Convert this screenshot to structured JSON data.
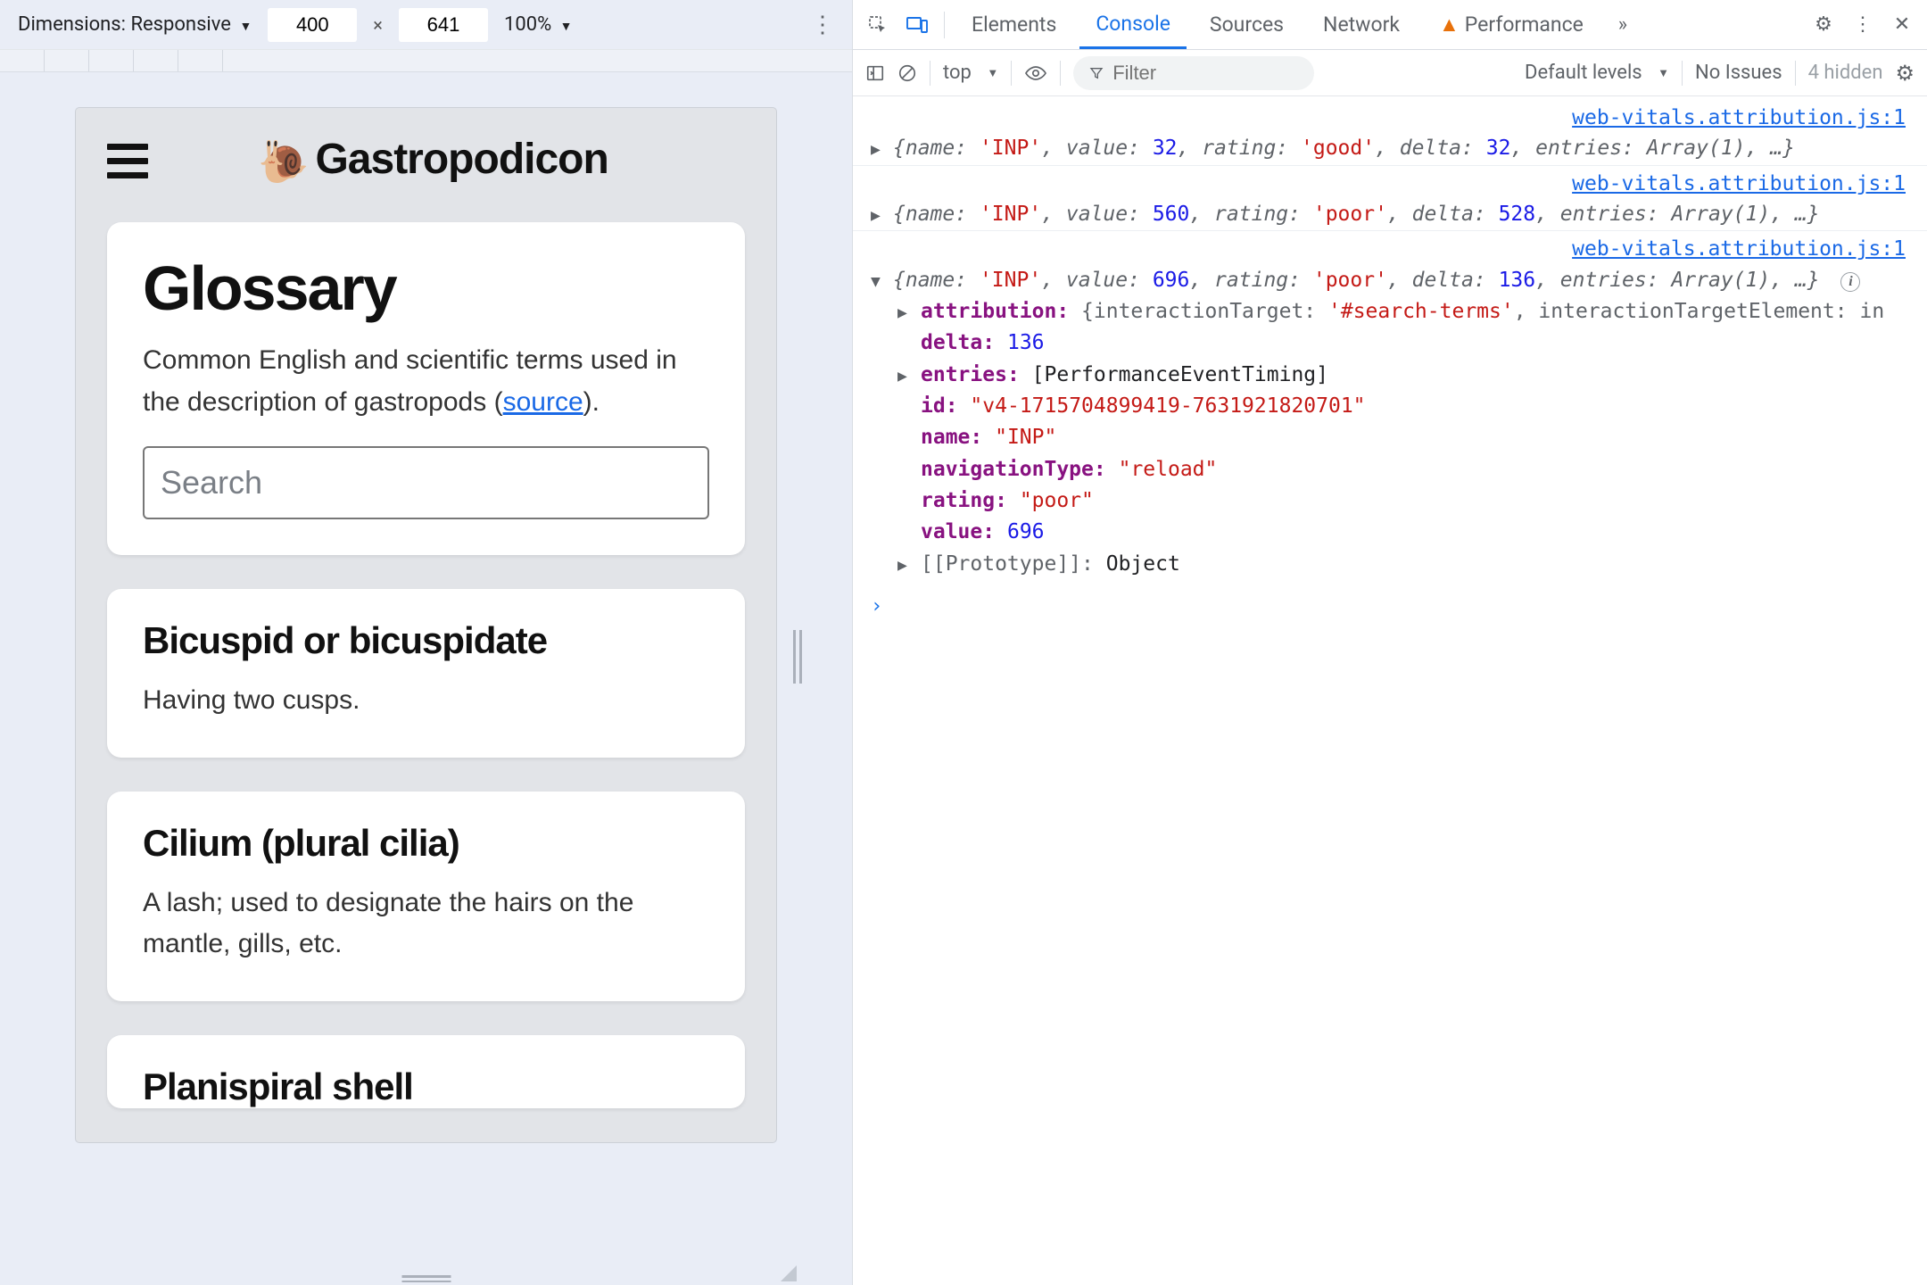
{
  "device_toolbar": {
    "dimensions_label": "Dimensions:",
    "device_name": "Responsive",
    "width": "400",
    "height": "641",
    "zoom": "100%"
  },
  "app": {
    "title": "Gastropodicon",
    "snail": "🐌",
    "glossary_heading": "Glossary",
    "glossary_desc_prefix": "Common English and scientific terms used in the description of gastropods (",
    "glossary_source": "source",
    "glossary_desc_suffix": ").",
    "search_placeholder": "Search",
    "terms": [
      {
        "title": "Bicuspid or bicuspidate",
        "def": "Having two cusps."
      },
      {
        "title": "Cilium (plural cilia)",
        "def": "A lash; used to designate the hairs on the mantle, gills, etc."
      },
      {
        "title": "Planispiral shell",
        "def": ""
      }
    ]
  },
  "devtools": {
    "tabs": {
      "elements": "Elements",
      "console": "Console",
      "sources": "Sources",
      "network": "Network",
      "performance": "Performance"
    },
    "console_toolbar": {
      "context": "top",
      "filter_placeholder": "Filter",
      "levels": "Default levels",
      "no_issues": "No Issues",
      "hidden": "4 hidden"
    },
    "source_link": "web-vitals.attribution.js:1",
    "logs": {
      "l1": {
        "name": "'INP'",
        "value": "32",
        "rating": "'good'",
        "delta": "32",
        "entries": "Array(1)",
        "tail": ", …}"
      },
      "l2": {
        "name": "'INP'",
        "value": "560",
        "rating": "'poor'",
        "delta": "528",
        "entries": "Array(1)",
        "tail": ", …}"
      },
      "l3": {
        "name": "'INP'",
        "value": "696",
        "rating": "'poor'",
        "delta": "136",
        "entries": "Array(1)",
        "tail": ", …}"
      },
      "expanded": {
        "attribution_target": "'#search-terms'",
        "attribution_tail": "interactionTargetElement:",
        "attribution_trunc": "in",
        "delta": "136",
        "entries": "[PerformanceEventTiming]",
        "id": "\"v4-1715704899419-7631921820701\"",
        "name": "\"INP\"",
        "navigationType": "\"reload\"",
        "rating": "\"poor\"",
        "value": "696",
        "proto": "Object"
      }
    },
    "prompt": "›"
  }
}
